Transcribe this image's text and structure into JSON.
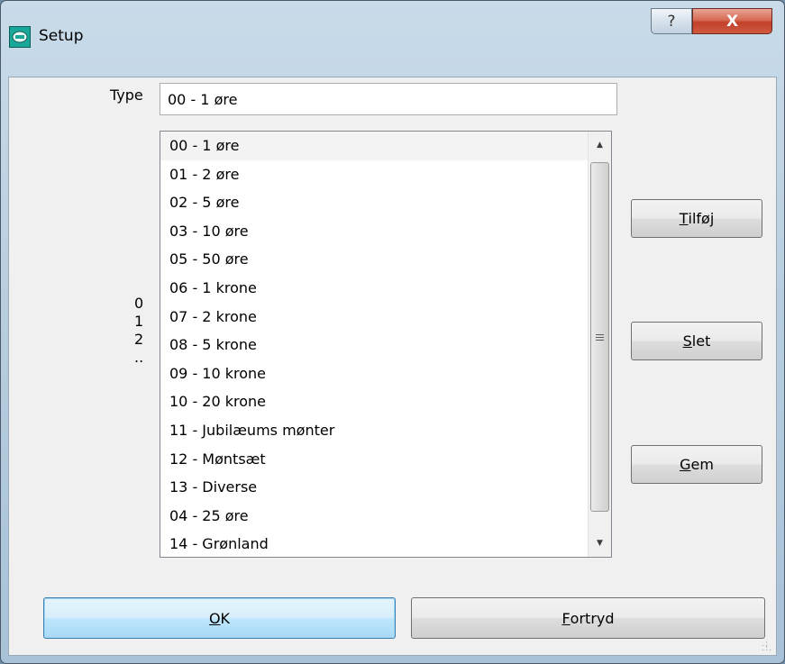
{
  "window": {
    "title": "Setup",
    "help_label": "?",
    "close_label": "X"
  },
  "type_field": {
    "label": "Type",
    "value": "00 - 1 øre"
  },
  "list": {
    "items": [
      "00 - 1 øre",
      "01 - 2 øre",
      "02 - 5 øre",
      "03 - 10 øre",
      "05 - 50 øre",
      "06 - 1 krone",
      "07 - 2 krone",
      "08 - 5 krone",
      "09 - 10 krone",
      "10 - 20 krone",
      "11 - Jubilæums mønter",
      "12 - Møntsæt",
      "13 - Diverse",
      "04 - 25 øre",
      "14 - Grønland"
    ],
    "selected_index": 0
  },
  "side_numbers": [
    "0",
    "1",
    "2",
    ".."
  ],
  "buttons": {
    "add": {
      "prefix": "",
      "mnemonic": "T",
      "rest": "ilføj"
    },
    "delete": {
      "prefix": "",
      "mnemonic": "S",
      "rest": "let"
    },
    "save": {
      "prefix": "",
      "mnemonic": "G",
      "rest": "em"
    },
    "ok": {
      "prefix": "",
      "mnemonic": "O",
      "rest": "K"
    },
    "cancel": {
      "prefix": "",
      "mnemonic": "F",
      "rest": "ortryd"
    }
  }
}
